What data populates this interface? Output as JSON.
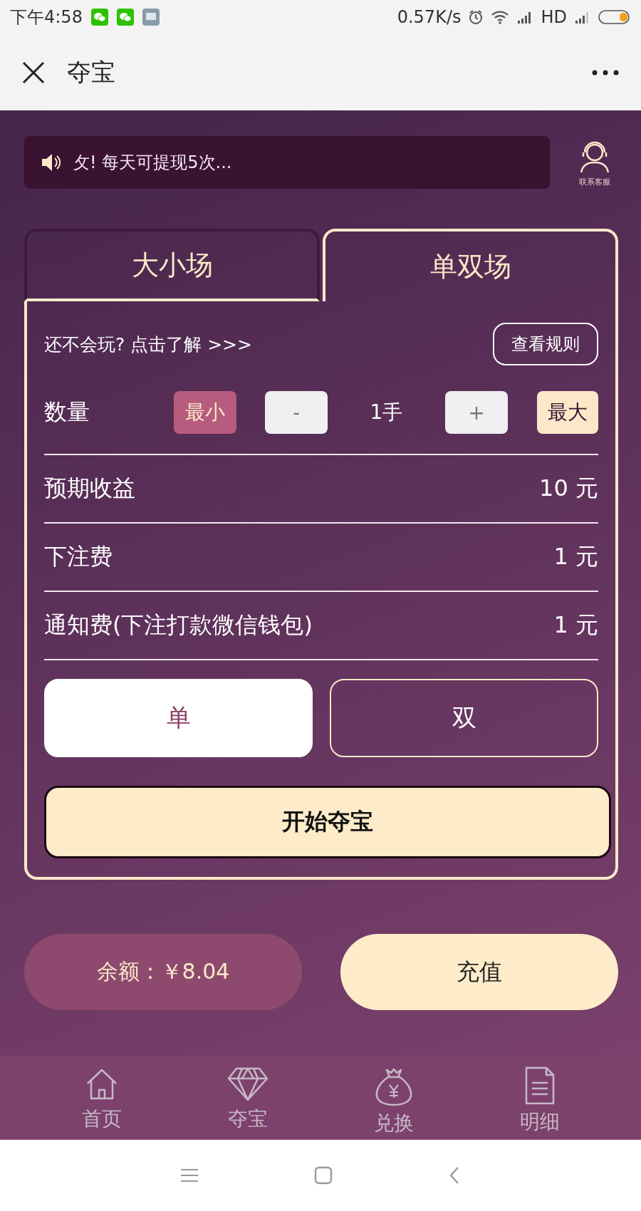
{
  "status_bar": {
    "time": "下午4:58",
    "speed": "0.57K/s",
    "network": "HD"
  },
  "header": {
    "title": "夺宝"
  },
  "notice": {
    "text": "攵! 每天可提现5次...",
    "service_label": "联系客服"
  },
  "tabs": [
    {
      "label": "大小场",
      "selected": false
    },
    {
      "label": "单双场",
      "selected": true
    }
  ],
  "help": {
    "text": "还不会玩? 点击了解 >>>",
    "rules_button": "查看规则"
  },
  "quantity": {
    "label": "数量",
    "min": "最小",
    "minus": "-",
    "value": "1手",
    "plus": "+",
    "max": "最大"
  },
  "rows": [
    {
      "label": "预期收益",
      "value": "10 元"
    },
    {
      "label": "下注费",
      "value": "1 元"
    },
    {
      "label": "通知费(下注打款微信钱包)",
      "value": "1 元"
    }
  ],
  "choices": [
    {
      "label": "单",
      "selected": true
    },
    {
      "label": "双",
      "selected": false
    }
  ],
  "start_button": "开始夺宝",
  "balance": "余额：￥8.04",
  "recharge_button": "充值",
  "nav": [
    {
      "label": "首页",
      "kind": "home"
    },
    {
      "label": "夺宝",
      "kind": "diamond"
    },
    {
      "label": "兑换",
      "kind": "bag"
    },
    {
      "label": "明细",
      "kind": "doc"
    }
  ]
}
